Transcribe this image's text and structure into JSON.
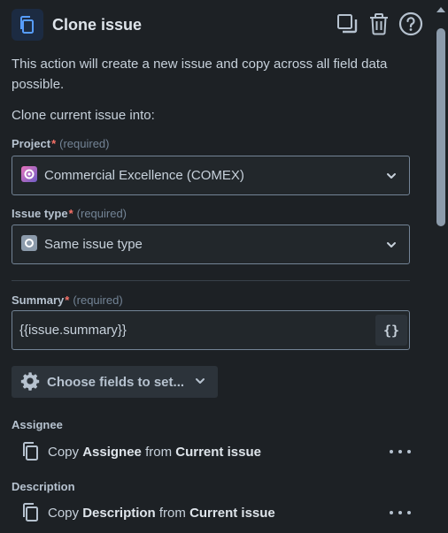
{
  "header": {
    "title": "Clone issue",
    "icon": "clone-icon",
    "actions": [
      {
        "name": "duplicate-icon"
      },
      {
        "name": "trash-icon"
      },
      {
        "name": "help-icon"
      }
    ]
  },
  "description": "This action will create a new issue and copy across all field data possible.",
  "clone_into_label": "Clone current issue into:",
  "project": {
    "label": "Project",
    "required_mark": "*",
    "required_text": "(required)",
    "value": "Commercial Excellence (COMEX)",
    "icon": "project-avatar-icon"
  },
  "issue_type": {
    "label": "Issue type",
    "required_mark": "*",
    "required_text": "(required)",
    "value": "Same issue type",
    "icon": "issue-type-icon"
  },
  "summary": {
    "label": "Summary",
    "required_mark": "*",
    "required_text": "(required)",
    "value": "{{issue.summary}}",
    "smart_value_button": "{}"
  },
  "choose_fields": {
    "label": "Choose fields to set...",
    "icon": "gear-icon"
  },
  "fields": [
    {
      "label": "Assignee",
      "copy_text": "Copy",
      "field_name": "Assignee",
      "from_text": "from",
      "source": "Current issue"
    },
    {
      "label": "Description",
      "copy_text": "Copy",
      "field_name": "Description",
      "from_text": "from",
      "source": "Current issue"
    }
  ],
  "colors": {
    "background": "#1d2125",
    "accent": "#579dff",
    "required": "#f87168",
    "border": "#738496"
  }
}
